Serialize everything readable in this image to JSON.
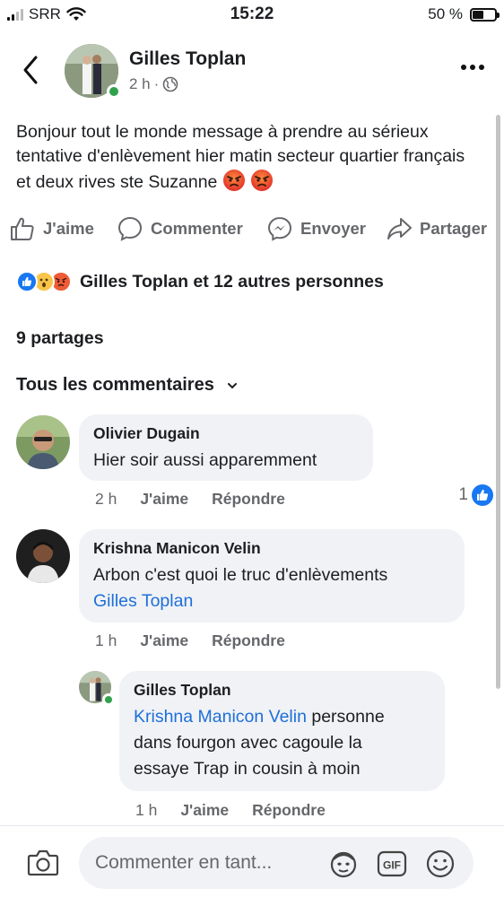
{
  "status_bar": {
    "carrier": "SRR",
    "time": "15:22",
    "battery_text": "50 %",
    "battery_level": 0.5
  },
  "post": {
    "author": "Gilles Toplan",
    "time": "2 h",
    "separator": "·",
    "privacy_icon": "globe-icon",
    "text": "Bonjour tout le monde message à prendre au sérieux tentative d'enlèvement hier matin secteur quartier français et deux rives ste Suzanne",
    "emojis": [
      "angry-face",
      "angry-face"
    ]
  },
  "actions": {
    "like": "J'aime",
    "comment": "Commenter",
    "send": "Envoyer",
    "share": "Partager"
  },
  "reactions": {
    "icons": [
      "like",
      "wow",
      "angry"
    ],
    "text": "Gilles Toplan et 12 autres personnes"
  },
  "shares": "9 partages",
  "comments_filter": "Tous les commentaires",
  "comments": [
    {
      "author": "Olivier Dugain",
      "text": "Hier soir aussi apparemment",
      "time": "2 h",
      "like": "J'aime",
      "reply": "Répondre",
      "like_count": "1"
    },
    {
      "author": "Krishna Manicon Velin",
      "text": "Arbon c'est quoi le truc d'enlèvements",
      "mention": "Gilles Toplan",
      "time": "1 h",
      "like": "J'aime",
      "reply": "Répondre"
    }
  ],
  "reply": {
    "author": "Gilles Toplan",
    "mention": "Krishna Manicon Velin",
    "text_part1": " personne",
    "text_part2": "dans fourgon avec cagoule la",
    "text_part3": "essaye Trap in cousin à moin",
    "time": "1 h",
    "like": "J'aime",
    "reply": "Répondre"
  },
  "composer": {
    "placeholder": "Commenter en tant...",
    "icons": [
      "camera-icon",
      "avatar-sticker-icon",
      "gif-icon",
      "emoji-icon"
    ]
  },
  "colors": {
    "accent": "#1e6fd9",
    "online": "#31a24c",
    "muted": "#65676b",
    "bubble": "#f0f2f5"
  }
}
